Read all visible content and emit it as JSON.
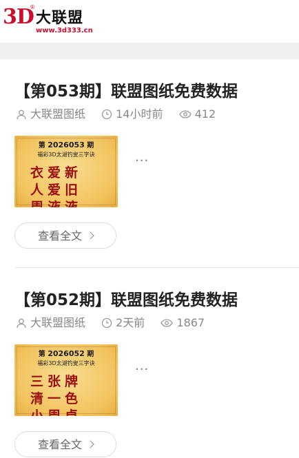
{
  "logo": {
    "mark": "3D",
    "reg": "®",
    "name": "大联盟",
    "url": "www.3d333.cn"
  },
  "posts": [
    {
      "title": "【第053期】联盟图纸免费数据",
      "author": "大联盟图纸",
      "time": "14小时前",
      "views": "412",
      "excerpt": "...",
      "read_more": "查看全文",
      "thumb": {
        "issue_prefix": "第",
        "issue_number": "2026053",
        "issue_suffix": "期",
        "subtitle": "福彩3D太湖钓叟三字诀",
        "lines": [
          "衣爱新",
          "人爱旧",
          "周液液"
        ]
      }
    },
    {
      "title": "【第052期】联盟图纸免费数据",
      "author": "大联盟图纸",
      "time": "2天前",
      "views": "1867",
      "excerpt": "...",
      "read_more": "查看全文",
      "thumb": {
        "issue_prefix": "第",
        "issue_number": "2026052",
        "issue_suffix": "期",
        "subtitle": "福彩3D太湖钓叟三字诀",
        "lines": [
          "三张牌",
          "清一色",
          "小周卓"
        ]
      }
    }
  ]
}
